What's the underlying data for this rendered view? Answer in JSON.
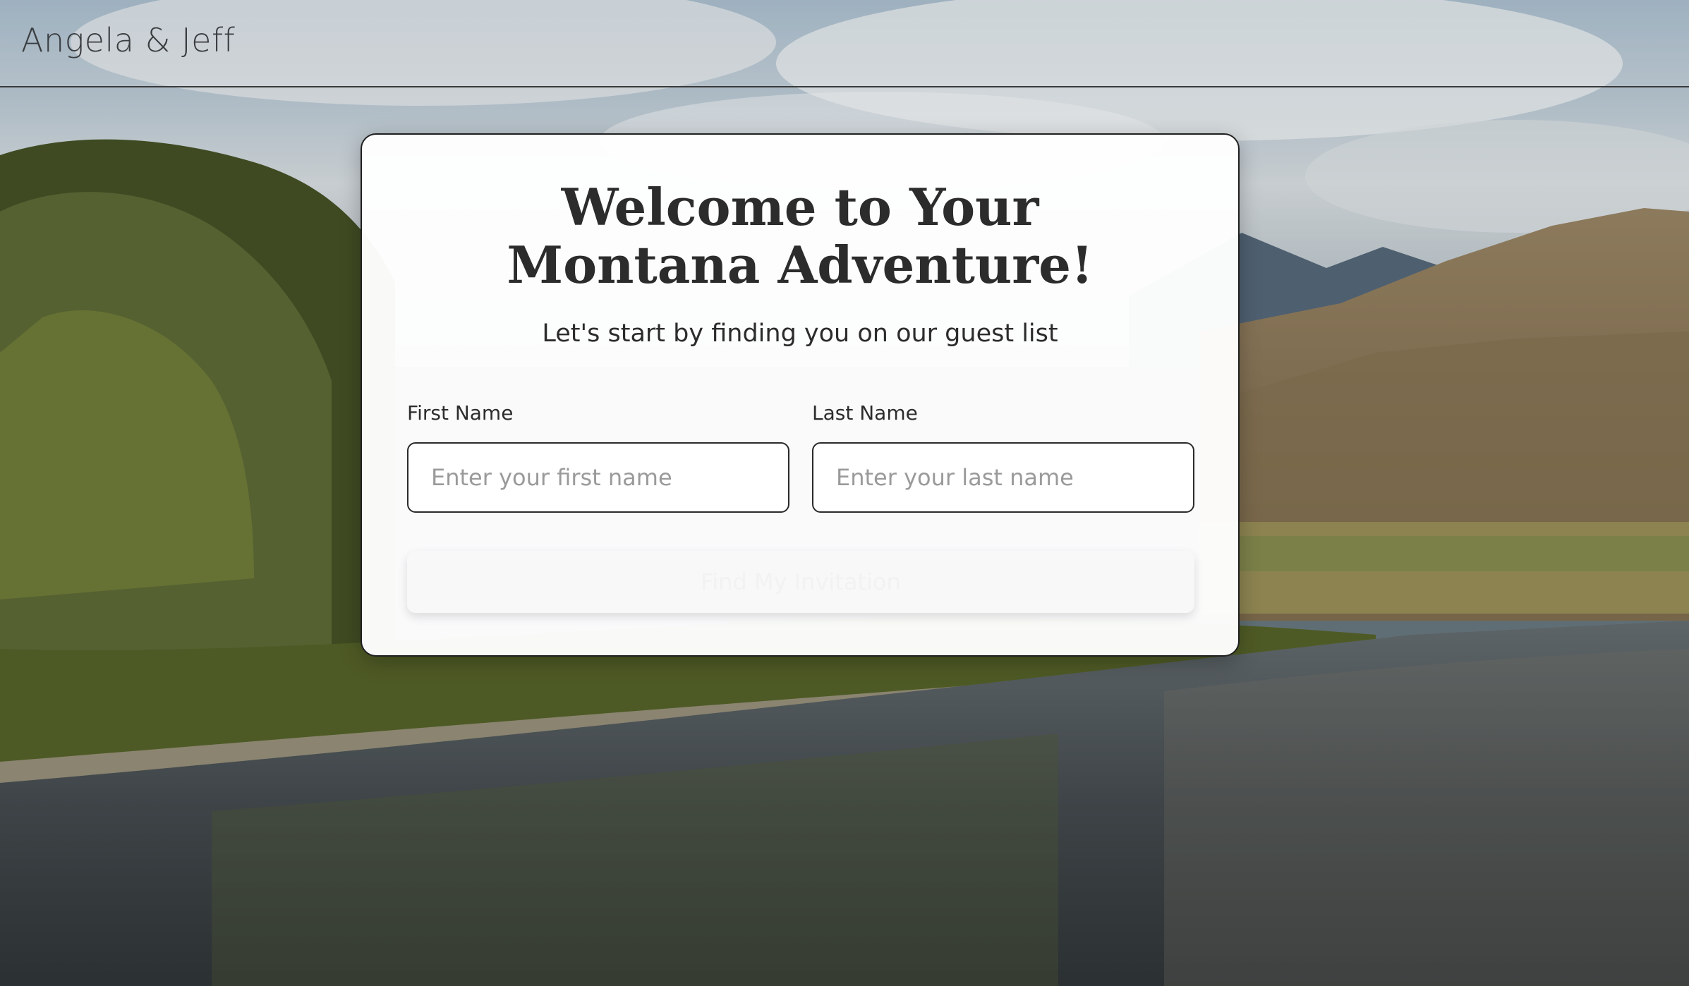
{
  "header": {
    "brand": "Angela & Jeff"
  },
  "card": {
    "title": "Welcome to Your Montana Adventure!",
    "subtitle": "Let's start by finding you on our guest list",
    "first_name": {
      "label": "First Name",
      "value": "",
      "placeholder": "Enter your first name"
    },
    "last_name": {
      "label": "Last Name",
      "value": "",
      "placeholder": "Enter your last name"
    },
    "submit_label": "Find My Invitation"
  },
  "colors": {
    "text": "#2c2c2c",
    "border": "#2a2a2a",
    "card_bg": "#ffffff",
    "placeholder": "#9a9a9a"
  }
}
